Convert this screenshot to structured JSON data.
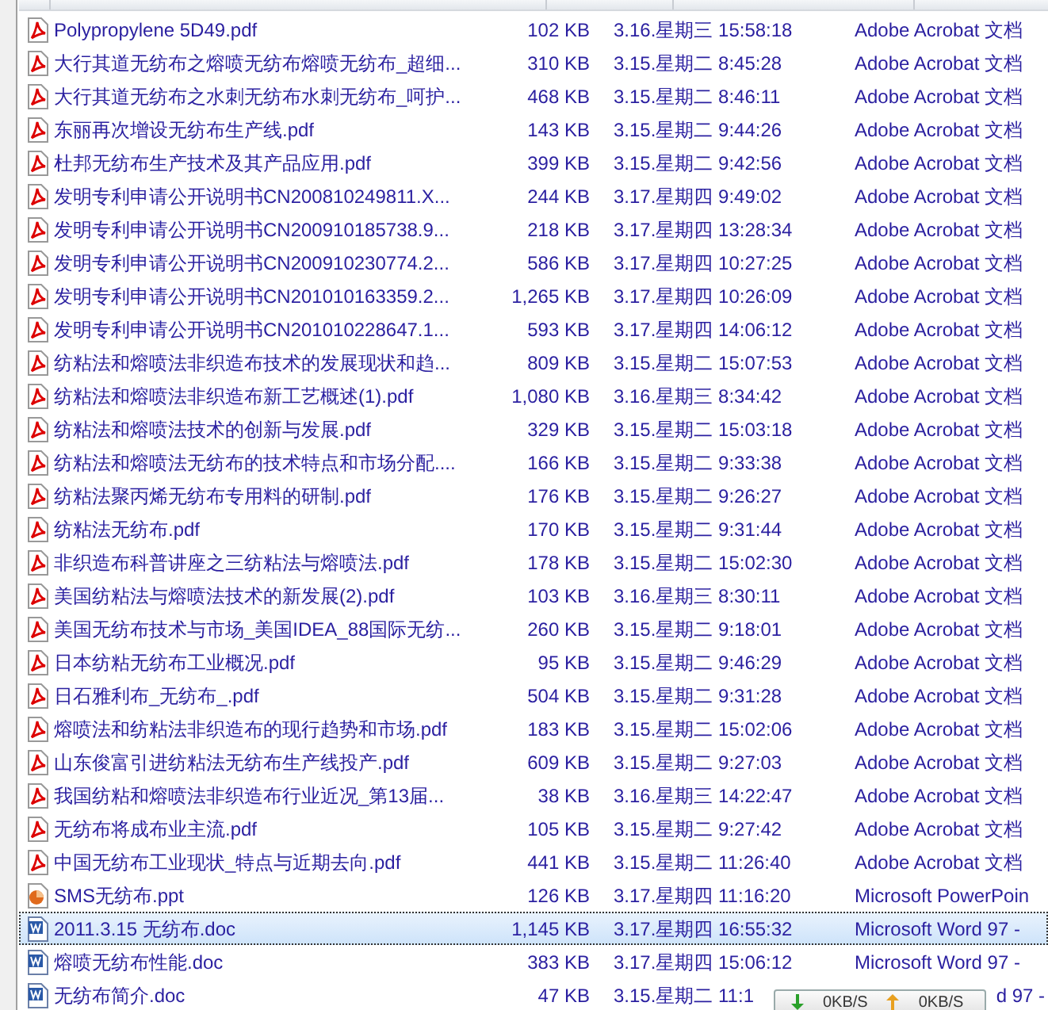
{
  "files": [
    {
      "name": "Polypropylene 5D49.pdf",
      "size": "102 KB",
      "date": "3.16.星期三 15:58:18",
      "type": "Adobe Acrobat 文档",
      "kind": "pdf",
      "selected": false
    },
    {
      "name": "大行其道无纺布之熔喷无纺布熔喷无纺布_超细...",
      "size": "310 KB",
      "date": "3.15.星期二 8:45:28",
      "type": "Adobe Acrobat 文档",
      "kind": "pdf",
      "selected": false
    },
    {
      "name": "大行其道无纺布之水刺无纺布水刺无纺布_呵护...",
      "size": "468 KB",
      "date": "3.15.星期二 8:46:11",
      "type": "Adobe Acrobat 文档",
      "kind": "pdf",
      "selected": false
    },
    {
      "name": "东丽再次增设无纺布生产线.pdf",
      "size": "143 KB",
      "date": "3.15.星期二 9:44:26",
      "type": "Adobe Acrobat 文档",
      "kind": "pdf",
      "selected": false
    },
    {
      "name": "杜邦无纺布生产技术及其产品应用.pdf",
      "size": "399 KB",
      "date": "3.15.星期二 9:42:56",
      "type": "Adobe Acrobat 文档",
      "kind": "pdf",
      "selected": false
    },
    {
      "name": "发明专利申请公开说明书CN200810249811.X...",
      "size": "244 KB",
      "date": "3.17.星期四 9:49:02",
      "type": "Adobe Acrobat 文档",
      "kind": "pdf",
      "selected": false
    },
    {
      "name": "发明专利申请公开说明书CN200910185738.9...",
      "size": "218 KB",
      "date": "3.17.星期四 13:28:34",
      "type": "Adobe Acrobat 文档",
      "kind": "pdf",
      "selected": false
    },
    {
      "name": "发明专利申请公开说明书CN200910230774.2...",
      "size": "586 KB",
      "date": "3.17.星期四 10:27:25",
      "type": "Adobe Acrobat 文档",
      "kind": "pdf",
      "selected": false
    },
    {
      "name": "发明专利申请公开说明书CN201010163359.2...",
      "size": "1,265 KB",
      "date": "3.17.星期四 10:26:09",
      "type": "Adobe Acrobat 文档",
      "kind": "pdf",
      "selected": false
    },
    {
      "name": "发明专利申请公开说明书CN201010228647.1...",
      "size": "593 KB",
      "date": "3.17.星期四 14:06:12",
      "type": "Adobe Acrobat 文档",
      "kind": "pdf",
      "selected": false
    },
    {
      "name": "纺粘法和熔喷法非织造布技术的发展现状和趋...",
      "size": "809 KB",
      "date": "3.15.星期二 15:07:53",
      "type": "Adobe Acrobat 文档",
      "kind": "pdf",
      "selected": false
    },
    {
      "name": "纺粘法和熔喷法非织造布新工艺概述(1).pdf",
      "size": "1,080 KB",
      "date": "3.16.星期三 8:34:42",
      "type": "Adobe Acrobat 文档",
      "kind": "pdf",
      "selected": false
    },
    {
      "name": "纺粘法和熔喷法技术的创新与发展.pdf",
      "size": "329 KB",
      "date": "3.15.星期二 15:03:18",
      "type": "Adobe Acrobat 文档",
      "kind": "pdf",
      "selected": false
    },
    {
      "name": "纺粘法和熔喷法无纺布的技术特点和市场分配....",
      "size": "166 KB",
      "date": "3.15.星期二 9:33:38",
      "type": "Adobe Acrobat 文档",
      "kind": "pdf",
      "selected": false
    },
    {
      "name": "纺粘法聚丙烯无纺布专用料的研制.pdf",
      "size": "176 KB",
      "date": "3.15.星期二 9:26:27",
      "type": "Adobe Acrobat 文档",
      "kind": "pdf",
      "selected": false
    },
    {
      "name": "纺粘法无纺布.pdf",
      "size": "170 KB",
      "date": "3.15.星期二 9:31:44",
      "type": "Adobe Acrobat 文档",
      "kind": "pdf",
      "selected": false
    },
    {
      "name": "非织造布科普讲座之三纺粘法与熔喷法.pdf",
      "size": "178 KB",
      "date": "3.15.星期二 15:02:30",
      "type": "Adobe Acrobat 文档",
      "kind": "pdf",
      "selected": false
    },
    {
      "name": "美国纺粘法与熔喷法技术的新发展(2).pdf",
      "size": "103 KB",
      "date": "3.16.星期三 8:30:11",
      "type": "Adobe Acrobat 文档",
      "kind": "pdf",
      "selected": false
    },
    {
      "name": "美国无纺布技术与市场_美国IDEA_88国际无纺...",
      "size": "260 KB",
      "date": "3.15.星期二 9:18:01",
      "type": "Adobe Acrobat 文档",
      "kind": "pdf",
      "selected": false
    },
    {
      "name": "日本纺粘无纺布工业概况.pdf",
      "size": "95 KB",
      "date": "3.15.星期二 9:46:29",
      "type": "Adobe Acrobat 文档",
      "kind": "pdf",
      "selected": false
    },
    {
      "name": "日石雅利布_无纺布_.pdf",
      "size": "504 KB",
      "date": "3.15.星期二 9:31:28",
      "type": "Adobe Acrobat 文档",
      "kind": "pdf",
      "selected": false
    },
    {
      "name": "熔喷法和纺粘法非织造布的现行趋势和市场.pdf",
      "size": "183 KB",
      "date": "3.15.星期二 15:02:06",
      "type": "Adobe Acrobat 文档",
      "kind": "pdf",
      "selected": false
    },
    {
      "name": "山东俊富引进纺粘法无纺布生产线投产.pdf",
      "size": "609 KB",
      "date": "3.15.星期二 9:27:03",
      "type": "Adobe Acrobat 文档",
      "kind": "pdf",
      "selected": false
    },
    {
      "name": "我国纺粘和熔喷法非织造布行业近况_第13届...",
      "size": "38 KB",
      "date": "3.16.星期三 14:22:47",
      "type": "Adobe Acrobat 文档",
      "kind": "pdf",
      "selected": false
    },
    {
      "name": "无纺布将成布业主流.pdf",
      "size": "105 KB",
      "date": "3.15.星期二 9:27:42",
      "type": "Adobe Acrobat 文档",
      "kind": "pdf",
      "selected": false
    },
    {
      "name": "中国无纺布工业现状_特点与近期去向.pdf",
      "size": "441 KB",
      "date": "3.15.星期二 11:26:40",
      "type": "Adobe Acrobat 文档",
      "kind": "pdf",
      "selected": false
    },
    {
      "name": "SMS无纺布.ppt",
      "size": "126 KB",
      "date": "3.17.星期四 11:16:20",
      "type": "Microsoft PowerPoin",
      "kind": "ppt",
      "selected": false
    },
    {
      "name": "2011.3.15 无纺布.doc",
      "size": "1,145 KB",
      "date": "3.17.星期四 16:55:32",
      "type": "Microsoft Word 97 -",
      "kind": "doc",
      "selected": true
    },
    {
      "name": "熔喷无纺布性能.doc",
      "size": "383 KB",
      "date": "3.17.星期四 15:06:12",
      "type": "Microsoft Word 97 -",
      "kind": "doc",
      "selected": false
    },
    {
      "name": "无纺布简介.doc",
      "size": "47 KB",
      "date": "3.15.星期二 11:1",
      "type": "d 97 -",
      "kind": "doc",
      "selected": false,
      "partly_hidden": true
    }
  ],
  "speed_meter": {
    "download": "0KB/S",
    "upload": "0KB/S"
  }
}
